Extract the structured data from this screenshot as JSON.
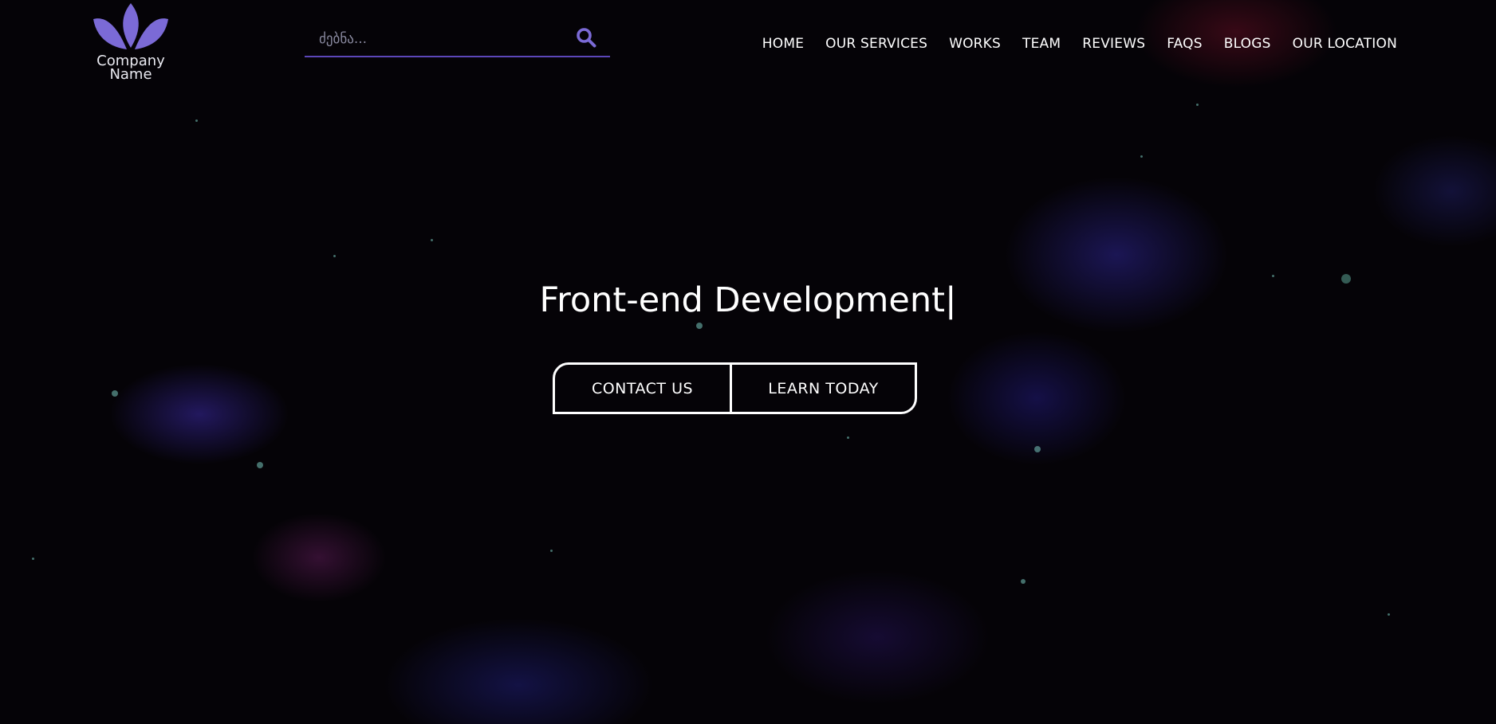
{
  "brand": {
    "logo_icon": "lotus-icon",
    "name_line1": "Company",
    "name_line2": "Name",
    "accent_color": "#7b6ad6"
  },
  "search": {
    "placeholder": "ძებნა...",
    "value": "",
    "icon": "search-icon"
  },
  "nav": {
    "items": [
      {
        "label": "HOME"
      },
      {
        "label": "OUR SERVICES"
      },
      {
        "label": "WORKS"
      },
      {
        "label": "TEAM"
      },
      {
        "label": "REVIEWS"
      },
      {
        "label": "FAQS"
      },
      {
        "label": "BLOGS"
      },
      {
        "label": "OUR LOCATION"
      }
    ]
  },
  "hero": {
    "title": "Front-end Development",
    "cursor": "|",
    "contact_label": "CONTACT US",
    "learn_label": "LEARN TODAY"
  }
}
